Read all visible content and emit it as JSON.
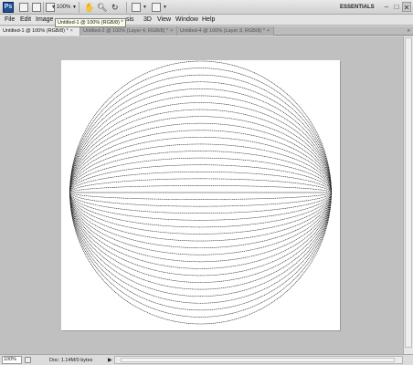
{
  "app": {
    "logo_text": "Ps"
  },
  "toolbar": {
    "zoom_label": "100%",
    "essentials_label": "ESSENTIALS",
    "icons": [
      "bridge-icon",
      "mini-bridge-icon",
      "screen-mode-icon",
      "hand-icon",
      "zoom-icon",
      "rotate-view-icon",
      "arrange-documents-icon",
      "screen-layout-icon"
    ]
  },
  "window_controls": {
    "minimize": "–",
    "maximize": "□",
    "close": "✕"
  },
  "menu": {
    "items": [
      {
        "label": "File"
      },
      {
        "label": "Edit"
      },
      {
        "label": "Image"
      },
      {
        "label": "sis"
      },
      {
        "label": "3D"
      },
      {
        "label": "View"
      },
      {
        "label": "Window"
      },
      {
        "label": "Help"
      }
    ]
  },
  "tooltip": {
    "text": "Untitled-1 @ 100% (RGB/8) *"
  },
  "tabs": [
    {
      "label": "Untitled-1 @ 100% (RGB/8) *",
      "active": true
    },
    {
      "label": "Untitled-2 @ 100% (Layer 4, RGB/8) *",
      "active": false
    },
    {
      "label": "Untitled-4 @ 100% (Layer 3, RGB/8) *",
      "active": false
    }
  ],
  "tab_close": "×",
  "tab_menu": "»",
  "canvas": {
    "background": "#ffffff",
    "stroke_color": "#222222",
    "ellipse_count": 19
  },
  "status": {
    "zoom": "100%",
    "doc_info": "Doc: 1.14M/0 bytes",
    "arrow": "▶"
  }
}
